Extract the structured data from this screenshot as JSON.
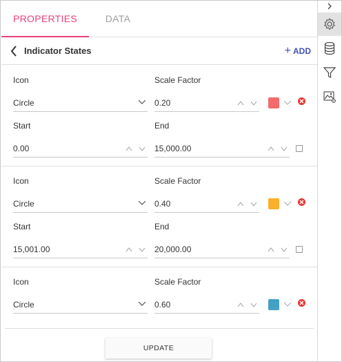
{
  "tabs": [
    {
      "label": "PROPERTIES",
      "active": true
    },
    {
      "label": "DATA",
      "active": false
    }
  ],
  "header": {
    "title": "Indicator States",
    "add_label": "ADD"
  },
  "labels": {
    "icon": "Icon",
    "scale_factor": "Scale Factor",
    "start": "Start",
    "end": "End"
  },
  "states": [
    {
      "icon": "Circle",
      "scale_factor": "0.20",
      "color": "#f36b6b",
      "start": "0.00",
      "end": "15,000.00"
    },
    {
      "icon": "Circle",
      "scale_factor": "0.40",
      "color": "#fbaf2c",
      "start": "15,001.00",
      "end": "20,000.00"
    },
    {
      "icon": "Circle",
      "scale_factor": "0.60",
      "color": "#43a1c3"
    }
  ],
  "update_label": "UPDATE",
  "rightbar": {
    "icons": [
      "chevron-right-icon",
      "gear-icon",
      "database-icon",
      "filter-icon",
      "image-settings-icon"
    ]
  },
  "colors": {
    "accent": "#e8417b",
    "link": "#3f51b5",
    "delete": "#e53935"
  }
}
